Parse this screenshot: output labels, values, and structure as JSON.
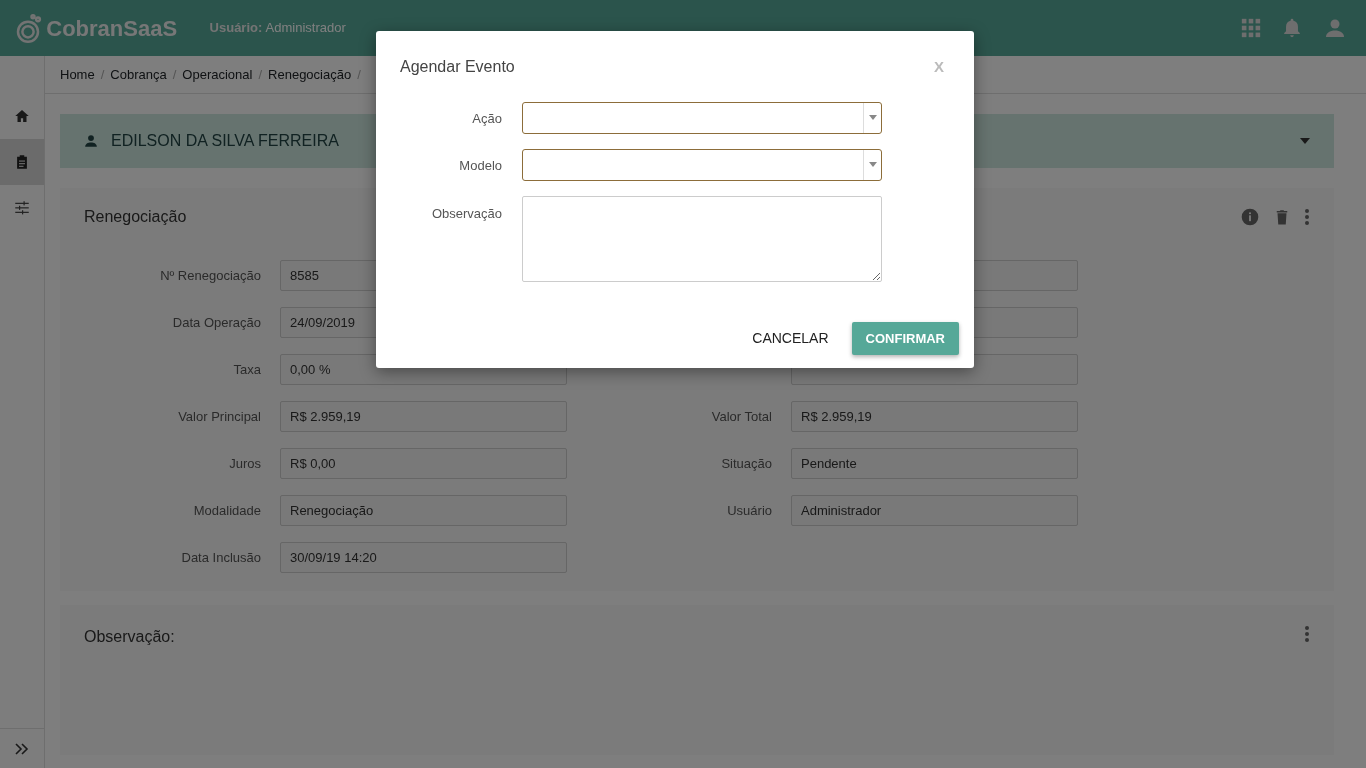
{
  "header": {
    "logo": "CobranSaaS",
    "user_label": "Usuário:",
    "user": "Administrador"
  },
  "sidebar": {
    "items": [
      {
        "kind": "home",
        "selected": false
      },
      {
        "kind": "clipboard",
        "selected": true
      },
      {
        "kind": "sliders",
        "selected": false
      }
    ]
  },
  "breadcrumb": {
    "separator": "/",
    "items": [
      "Home",
      "Cobrança",
      "Operacional",
      "Renegociação"
    ]
  },
  "client": {
    "name": "EDILSON DA SILVA FERREIRA"
  },
  "card": {
    "title": "Renegociação",
    "left_fields": [
      {
        "label": "Nº Renegociação",
        "value": "8585"
      },
      {
        "label": "Data Operação",
        "value": "24/09/2019"
      },
      {
        "label": "Taxa",
        "value": "0,00 %"
      },
      {
        "label": "Valor Principal",
        "value": "R$ 2.959,19"
      },
      {
        "label": "Juros",
        "value": "R$ 0,00"
      },
      {
        "label": "Modalidade",
        "value": "Renegociação"
      },
      {
        "label": "Data Inclusão",
        "value": "30/09/19 14:20"
      }
    ],
    "right_fields": [
      {
        "kind": "field"
      },
      {
        "kind": "field"
      },
      {
        "kind": "field"
      },
      {
        "kind": "field",
        "label": "Valor Total",
        "value": "R$ 2.959,19"
      },
      {
        "kind": "field",
        "label": "Situação",
        "value": "Pendente"
      },
      {
        "kind": "field",
        "label": "Usuário",
        "value": "Administrador"
      }
    ]
  },
  "notes": {
    "title": "Observação:"
  },
  "modal": {
    "title": "Agendar Evento",
    "close": "X",
    "fields": [
      {
        "label": "Ação",
        "kind": "select"
      },
      {
        "label": "Modelo",
        "kind": "select"
      },
      {
        "label": "Observação",
        "kind": "textarea"
      }
    ],
    "buttons": [
      {
        "label": "CANCELAR",
        "kind": "flat"
      },
      {
        "label": "CONFIRMAR",
        "kind": "primary"
      }
    ]
  }
}
